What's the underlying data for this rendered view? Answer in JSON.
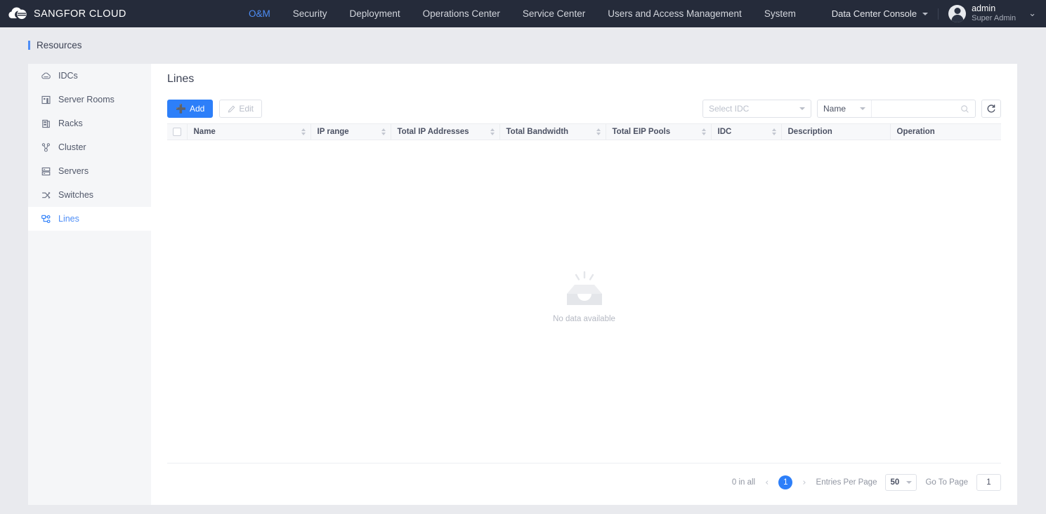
{
  "header": {
    "brand": "SANGFOR CLOUD",
    "brand_logo_icon": "cloud-sphere-logo-icon",
    "nav": [
      {
        "label": "O&M",
        "active": true
      },
      {
        "label": "Security",
        "active": false
      },
      {
        "label": "Deployment",
        "active": false
      },
      {
        "label": "Operations Center",
        "active": false
      },
      {
        "label": "Service Center",
        "active": false
      },
      {
        "label": "Users and Access Management",
        "active": false
      },
      {
        "label": "System",
        "active": false
      }
    ],
    "console_selector": "Data Center Console",
    "console_caret_icon": "caret-down-icon",
    "user": {
      "name": "admin",
      "role": "Super Admin",
      "avatar_icon": "user-avatar-icon",
      "chevron_icon": "chevron-down-icon"
    }
  },
  "breadcrumb": {
    "label": "Resources"
  },
  "sidebar": {
    "items": [
      {
        "label": "IDCs",
        "icon": "cloud-icon",
        "active": false
      },
      {
        "label": "Server Rooms",
        "icon": "building-icon",
        "active": false
      },
      {
        "label": "Racks",
        "icon": "rack-icon",
        "active": false
      },
      {
        "label": "Cluster",
        "icon": "cluster-icon",
        "active": false
      },
      {
        "label": "Servers",
        "icon": "server-icon",
        "active": false
      },
      {
        "label": "Switches",
        "icon": "switch-icon",
        "active": false
      },
      {
        "label": "Lines",
        "icon": "lines-icon",
        "active": true
      }
    ]
  },
  "main": {
    "title": "Lines",
    "toolbar": {
      "add_label": "Add",
      "add_icon": "plus-icon",
      "edit_label": "Edit",
      "edit_icon": "pencil-icon",
      "edit_disabled": true
    },
    "filters": {
      "idc_placeholder": "Select IDC",
      "idc_caret_icon": "caret-down-icon",
      "search_field": "Name",
      "search_field_caret_icon": "caret-down-icon",
      "search_value": "",
      "search_placeholder": "",
      "search_icon": "search-icon",
      "refresh_icon": "refresh-icon"
    },
    "table": {
      "select_all_icon": "checkbox-icon",
      "columns": [
        {
          "label": "Name",
          "sortable": true
        },
        {
          "label": "IP range",
          "sortable": true
        },
        {
          "label": "Total IP Addresses",
          "sortable": true
        },
        {
          "label": "Total Bandwidth",
          "sortable": true
        },
        {
          "label": "Total EIP Pools",
          "sortable": true
        },
        {
          "label": "IDC",
          "sortable": true
        },
        {
          "label": "Description",
          "sortable": false
        },
        {
          "label": "Operation",
          "sortable": false
        }
      ],
      "rows": [],
      "empty_text": "No data available",
      "empty_icon": "empty-box-icon"
    },
    "pagination": {
      "total_text": "0 in all",
      "prev_icon": "chevron-left-icon",
      "next_icon": "chevron-right-icon",
      "current_page": "1",
      "entries_label": "Entries Per Page",
      "entries_value": "50",
      "entries_caret_icon": "caret-down-icon",
      "goto_label": "Go To Page",
      "goto_value": "1"
    }
  },
  "colors": {
    "header_bg": "#252b3a",
    "accent": "#2d7ff9",
    "nav_active": "#4e8ef7",
    "page_bg": "#e9eaee",
    "sidebar_bg": "#f5f6f8",
    "panel_bg": "#ffffff"
  }
}
